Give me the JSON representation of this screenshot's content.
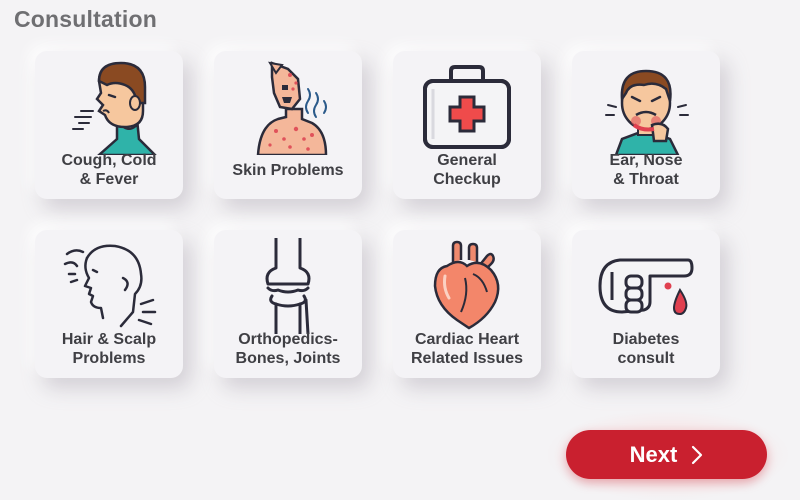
{
  "header": {
    "title": "Consultation"
  },
  "cards": [
    {
      "line1": "Cough, Cold",
      "line2": "& Fever",
      "icon": "cough-person-icon"
    },
    {
      "line1": "Skin Problems",
      "line2": "",
      "icon": "skin-rash-icon"
    },
    {
      "line1": "General",
      "line2": "Checkup",
      "icon": "first-aid-kit-icon"
    },
    {
      "line1": "Ear, Nose",
      "line2": "& Throat",
      "icon": "sore-throat-person-icon"
    },
    {
      "line1": "Hair & Scalp",
      "line2": "Problems",
      "icon": "head-profile-icon"
    },
    {
      "line1": "Orthopedics-",
      "line2": "Bones, Joints",
      "icon": "knee-joint-icon"
    },
    {
      "line1": "Cardiac Heart",
      "line2": "Related Issues",
      "icon": "heart-icon"
    },
    {
      "line1": "Diabetes",
      "line2": "consult",
      "icon": "finger-blood-drop-icon"
    }
  ],
  "footer": {
    "next_label": "Next"
  },
  "colors": {
    "accent": "#c9202f",
    "background": "#f4f3f5"
  }
}
